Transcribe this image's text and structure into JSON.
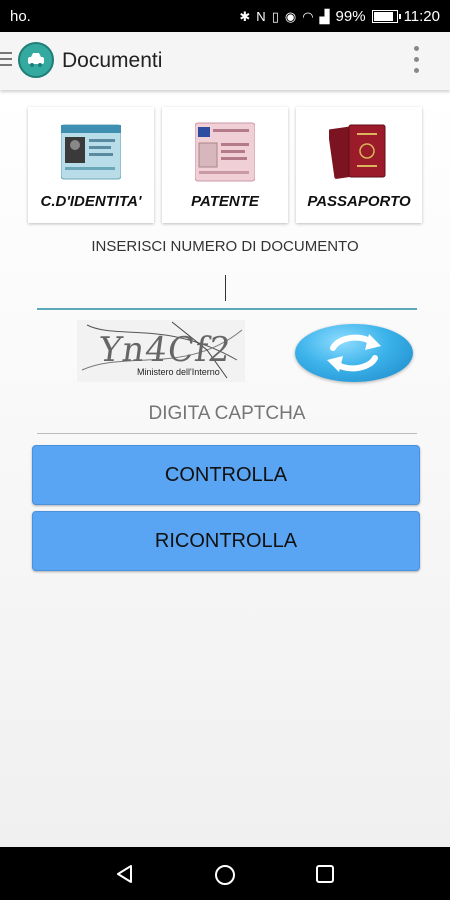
{
  "status_bar": {
    "carrier": "ho.",
    "battery_percent": "99%",
    "time": "11:20",
    "battery_level": 0.99
  },
  "app_bar": {
    "title": "Documenti"
  },
  "documents": [
    {
      "label": "C.D'IDENTITA'"
    },
    {
      "label": "PATENTE"
    },
    {
      "label": "PASSAPORTO"
    }
  ],
  "document_number": {
    "label": "INSERISCI NUMERO DI DOCUMENTO",
    "value": ""
  },
  "captcha": {
    "image_text": "Yn4Cf2",
    "image_subtext": "Ministero dell'Interno",
    "placeholder": "DIGITA CAPTCHA"
  },
  "buttons": {
    "check": "CONTROLLA",
    "recheck": "RICONTROLLA"
  },
  "colors": {
    "accent": "#59a4f3",
    "brand": "#34a9a0",
    "refresh": "#3cb3ea"
  }
}
